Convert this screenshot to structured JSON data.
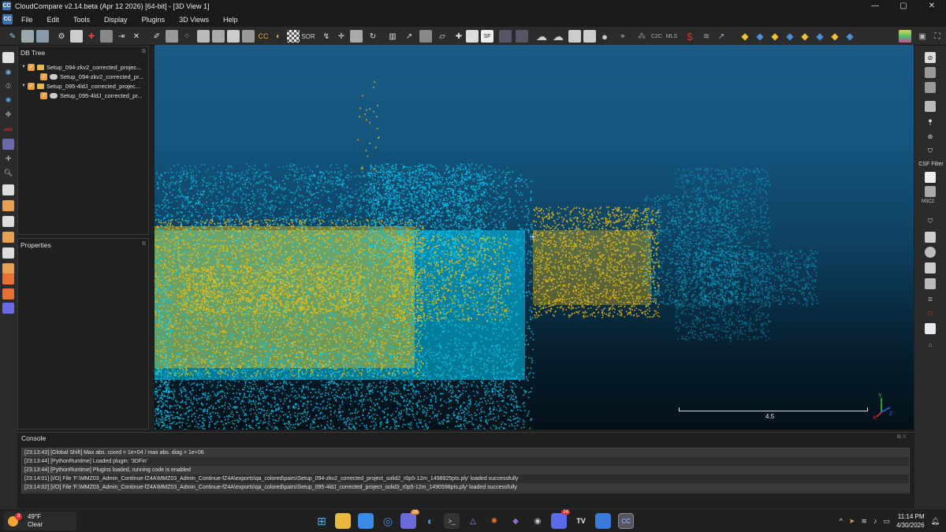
{
  "window": {
    "title": "CloudCompare v2.14.beta (Apr 12 2026) [64-bit] - [3D View 1]",
    "icon": "cc-app-icon",
    "controls": [
      "—",
      "▢",
      "✕"
    ]
  },
  "menu": {
    "items": [
      "File",
      "Edit",
      "Tools",
      "Display",
      "Plugins",
      "3D Views",
      "Help"
    ]
  },
  "toolbar": {
    "labels": {
      "sor": "SOR",
      "mls": "MLS",
      "c2c": "C2C"
    }
  },
  "db_tree": {
    "title": "DB Tree",
    "items": [
      {
        "label": "Setup_094-zkv2_corrected_projec...",
        "level": 0
      },
      {
        "label": "Setup_094-zkv2_corrected_pr...",
        "level": 1
      },
      {
        "label": "Setup_095-4ldJ_corrected_projec...",
        "level": 0
      },
      {
        "label": "Setup_095-4ldJ_corrected_pr...",
        "level": 1
      }
    ]
  },
  "properties": {
    "title": "Properties"
  },
  "view3d": {
    "scale_label": "4.5",
    "axes": {
      "x": "X",
      "y": "Y",
      "z": "Z"
    },
    "colors": {
      "cloud_a": "#00c8f0",
      "cloud_b": "#f0c010"
    }
  },
  "right_toolbar": {
    "csf_label": "CSF Filter",
    "m3c2_label": "M3C2"
  },
  "console": {
    "title": "Console",
    "lines": [
      "[23:13:43] [Global Shift] Max abs. coord = 1e+04 / max abs. diag = 1e+06",
      "[23:13:44] [PythonRuntime]     Loaded plugin: '3DFin'",
      "[23:13:44] [PythonRuntime] Plugins loaded, running code is enabled",
      "[23:14:01] [I/O] File 'F:\\MMZ03_Admin_Continue-fZ4A\\MMZ03_Admin_Continue-fZ4A\\exports\\qa_colored\\pairs\\Setup_094-zkv2_corrected_project_solid2_r0p5-12m_1498925pts.ply' loaded successfully",
      "[23:14:02] [I/O] File 'F:\\MMZ03_Admin_Continue-fZ4A\\MMZ03_Admin_Continue-fZ4A\\exports\\qa_colored\\pairs\\Setup_095-4ldJ_corrected_project_solid3_r0p5-12m_1490598pts.ply' loaded successfully"
    ]
  },
  "taskbar": {
    "weather": {
      "temp": "49°F",
      "condition": "Clear",
      "badge": "3"
    },
    "badges": {
      "teams": "26",
      "discord": "24"
    },
    "time": "11:14 PM",
    "date": "4/30/2026"
  }
}
